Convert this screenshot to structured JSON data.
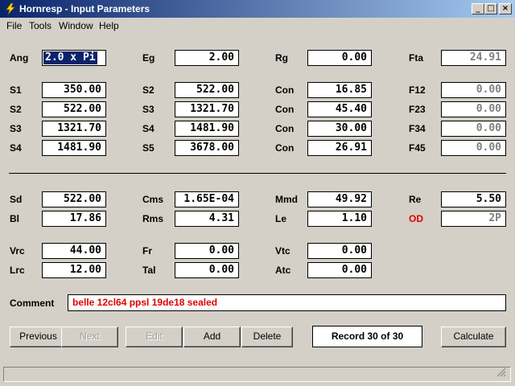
{
  "window": {
    "title": "Hornresp - Input Parameters",
    "controls": {
      "minimize": "_",
      "maximize": "□",
      "close": "×"
    }
  },
  "menu": {
    "file": "File",
    "tools": "Tools",
    "window": "Window",
    "help": "Help"
  },
  "params": {
    "ang": {
      "label": "Ang",
      "value": "2.0 x Pi"
    },
    "eg": {
      "label": "Eg",
      "value": "2.00"
    },
    "rg": {
      "label": "Rg",
      "value": "0.00"
    },
    "fta": {
      "label": "Fta",
      "value": "24.91"
    },
    "row1": {
      "s": "S1",
      "s_val": "350.00",
      "s2": "S2",
      "s2_val": "522.00",
      "con": "Con",
      "con_val": "16.85",
      "f": "F12",
      "f_val": "0.00"
    },
    "row2": {
      "s": "S2",
      "s_val": "522.00",
      "s2": "S3",
      "s2_val": "1321.70",
      "con": "Con",
      "con_val": "45.40",
      "f": "F23",
      "f_val": "0.00"
    },
    "row3": {
      "s": "S3",
      "s_val": "1321.70",
      "s2": "S4",
      "s2_val": "1481.90",
      "con": "Con",
      "con_val": "30.00",
      "f": "F34",
      "f_val": "0.00"
    },
    "row4": {
      "s": "S4",
      "s_val": "1481.90",
      "s2": "S5",
      "s2_val": "3678.00",
      "con": "Con",
      "con_val": "26.91",
      "f": "F45",
      "f_val": "0.00"
    },
    "sd": {
      "label": "Sd",
      "value": "522.00"
    },
    "cms": {
      "label": "Cms",
      "value": "1.65E-04"
    },
    "mmd": {
      "label": "Mmd",
      "value": "49.92"
    },
    "re": {
      "label": "Re",
      "value": "5.50"
    },
    "bl": {
      "label": "Bl",
      "value": "17.86"
    },
    "rms": {
      "label": "Rms",
      "value": "4.31"
    },
    "le": {
      "label": "Le",
      "value": "1.10"
    },
    "od": {
      "label": "OD",
      "value": "2P"
    },
    "vrc": {
      "label": "Vrc",
      "value": "44.00"
    },
    "fr": {
      "label": "Fr",
      "value": "0.00"
    },
    "vtc": {
      "label": "Vtc",
      "value": "0.00"
    },
    "lrc": {
      "label": "Lrc",
      "value": "12.00"
    },
    "tal": {
      "label": "Tal",
      "value": "0.00"
    },
    "atc": {
      "label": "Atc",
      "value": "0.00"
    }
  },
  "comment": {
    "label": "Comment",
    "value": "belle 12cl64 ppsl 19de18 sealed"
  },
  "buttons": {
    "previous": "Previous",
    "next": "Next",
    "edit": "Edit",
    "add": "Add",
    "delete": "Delete",
    "calculate": "Calculate"
  },
  "record": "Record 30 of 30",
  "colors": {
    "title_start": "#0a246a",
    "title_end": "#a6caf0",
    "accent_red": "#e00000",
    "face": "#d4d0c8"
  }
}
